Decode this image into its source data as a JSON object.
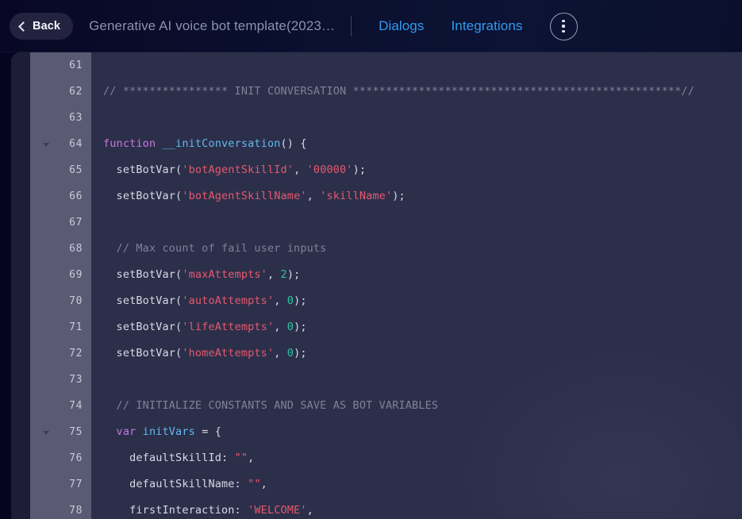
{
  "header": {
    "back_label": "Back",
    "doc_title": "Generative AI voice bot template(2023…",
    "nav": [
      {
        "label": "Dialogs"
      },
      {
        "label": "Integrations"
      }
    ],
    "kebab_name": "more-options"
  },
  "colors": {
    "page_bg": "#050521",
    "header_bg": "#0b1030",
    "panel_bg": "#1d1d38",
    "gutter_bg": "#5a5a74",
    "code_bg": "#2c2f4a",
    "accent_link": "#2f9bef",
    "back_btn_bg": "#232340",
    "comment": "#7e8298",
    "keyword": "#c678dd",
    "function": "#61b8ef",
    "string": "#e4596e",
    "number": "#2ec4a0",
    "plain_text": "#d7dae6"
  },
  "editor": {
    "first_visible_line": 61,
    "last_visible_line": 78,
    "lines": [
      {
        "num": "61",
        "fold": false,
        "tokens": []
      },
      {
        "num": "62",
        "fold": false,
        "tokens": [
          {
            "t": "comment",
            "v": "// **************** INIT CONVERSATION **************************************************//"
          }
        ]
      },
      {
        "num": "63",
        "fold": false,
        "tokens": []
      },
      {
        "num": "64",
        "fold": true,
        "tokens": [
          {
            "t": "keyword",
            "v": "function"
          },
          {
            "t": "plain",
            "v": " "
          },
          {
            "t": "func",
            "v": "__initConversation"
          },
          {
            "t": "punct",
            "v": "() {"
          }
        ]
      },
      {
        "num": "65",
        "fold": false,
        "tokens": [
          {
            "t": "plain",
            "v": "  setBotVar("
          },
          {
            "t": "string",
            "v": "'botAgentSkillId'"
          },
          {
            "t": "plain",
            "v": ", "
          },
          {
            "t": "string",
            "v": "'00000'"
          },
          {
            "t": "punct",
            "v": ");"
          }
        ]
      },
      {
        "num": "66",
        "fold": false,
        "tokens": [
          {
            "t": "plain",
            "v": "  setBotVar("
          },
          {
            "t": "string",
            "v": "'botAgentSkillName'"
          },
          {
            "t": "plain",
            "v": ", "
          },
          {
            "t": "string",
            "v": "'skillName'"
          },
          {
            "t": "punct",
            "v": ");"
          }
        ]
      },
      {
        "num": "67",
        "fold": false,
        "tokens": []
      },
      {
        "num": "68",
        "fold": false,
        "tokens": [
          {
            "t": "comment",
            "v": "  // Max count of fail user inputs"
          }
        ]
      },
      {
        "num": "69",
        "fold": false,
        "tokens": [
          {
            "t": "plain",
            "v": "  setBotVar("
          },
          {
            "t": "string",
            "v": "'maxAttempts'"
          },
          {
            "t": "plain",
            "v": ", "
          },
          {
            "t": "number",
            "v": "2"
          },
          {
            "t": "punct",
            "v": ");"
          }
        ]
      },
      {
        "num": "70",
        "fold": false,
        "tokens": [
          {
            "t": "plain",
            "v": "  setBotVar("
          },
          {
            "t": "string",
            "v": "'autoAttempts'"
          },
          {
            "t": "plain",
            "v": ", "
          },
          {
            "t": "number",
            "v": "0"
          },
          {
            "t": "punct",
            "v": ");"
          }
        ]
      },
      {
        "num": "71",
        "fold": false,
        "tokens": [
          {
            "t": "plain",
            "v": "  setBotVar("
          },
          {
            "t": "string",
            "v": "'lifeAttempts'"
          },
          {
            "t": "plain",
            "v": ", "
          },
          {
            "t": "number",
            "v": "0"
          },
          {
            "t": "punct",
            "v": ");"
          }
        ]
      },
      {
        "num": "72",
        "fold": false,
        "tokens": [
          {
            "t": "plain",
            "v": "  setBotVar("
          },
          {
            "t": "string",
            "v": "'homeAttempts'"
          },
          {
            "t": "plain",
            "v": ", "
          },
          {
            "t": "number",
            "v": "0"
          },
          {
            "t": "punct",
            "v": ");"
          }
        ]
      },
      {
        "num": "73",
        "fold": false,
        "tokens": []
      },
      {
        "num": "74",
        "fold": false,
        "tokens": [
          {
            "t": "comment",
            "v": "  // INITIALIZE CONSTANTS AND SAVE AS BOT VARIABLES"
          }
        ]
      },
      {
        "num": "75",
        "fold": true,
        "tokens": [
          {
            "t": "keyword",
            "v": "  var"
          },
          {
            "t": "plain",
            "v": " "
          },
          {
            "t": "func",
            "v": "initVars"
          },
          {
            "t": "plain",
            "v": " "
          },
          {
            "t": "punct",
            "v": "= {"
          }
        ]
      },
      {
        "num": "76",
        "fold": false,
        "tokens": [
          {
            "t": "plain",
            "v": "    defaultSkillId: "
          },
          {
            "t": "string",
            "v": "\"\""
          },
          {
            "t": "punct",
            "v": ","
          }
        ]
      },
      {
        "num": "77",
        "fold": false,
        "tokens": [
          {
            "t": "plain",
            "v": "    defaultSkillName: "
          },
          {
            "t": "string",
            "v": "\"\""
          },
          {
            "t": "punct",
            "v": ","
          }
        ]
      },
      {
        "num": "78",
        "fold": false,
        "tokens": [
          {
            "t": "plain",
            "v": "    firstInteraction: "
          },
          {
            "t": "string",
            "v": "'WELCOME'"
          },
          {
            "t": "punct",
            "v": ","
          }
        ]
      }
    ]
  }
}
